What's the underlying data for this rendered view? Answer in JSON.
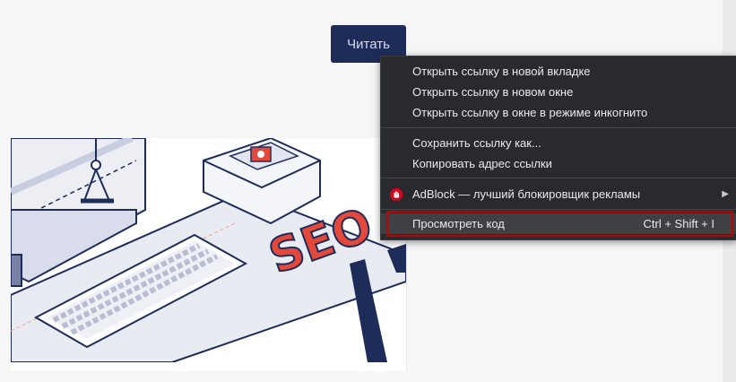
{
  "page": {
    "read_button": "Читать"
  },
  "context_menu": {
    "groups": [
      [
        {
          "label": "Открыть ссылку в новой вкладке"
        },
        {
          "label": "Открыть ссылку в новом окне"
        },
        {
          "label": "Открыть ссылку в окне в режиме инкогнито"
        }
      ],
      [
        {
          "label": "Сохранить ссылку как..."
        },
        {
          "label": "Копировать адрес ссылки"
        }
      ],
      [
        {
          "label": "AdBlock — лучший блокировщик рекламы",
          "icon": "adblock-hand-icon",
          "submenu": true
        }
      ],
      [
        {
          "label": "Просмотреть код",
          "shortcut": "Ctrl + Shift + I",
          "highlighted": true
        }
      ]
    ]
  },
  "illustration": {
    "sign_text": "SEO"
  },
  "colors": {
    "button_bg": "#1e2c5a",
    "menu_bg": "#292a2d",
    "highlight_border": "#c40000",
    "adblock_red": "#d0021b"
  }
}
